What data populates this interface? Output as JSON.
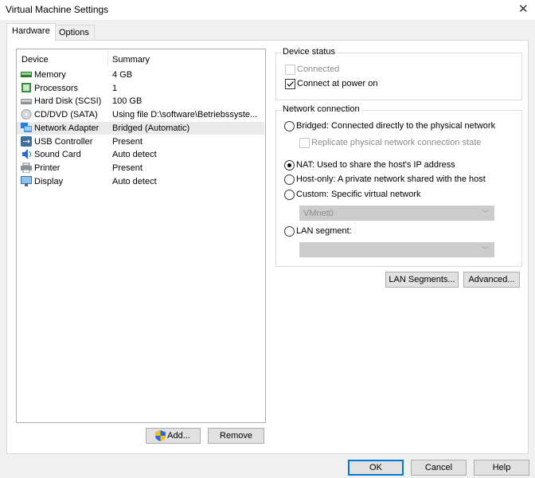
{
  "window": {
    "title": "Virtual Machine Settings",
    "close_icon": "close-icon"
  },
  "tabs": [
    {
      "label": "Hardware",
      "active": true
    },
    {
      "label": "Options",
      "active": false
    }
  ],
  "device_list": {
    "headers": {
      "device": "Device",
      "summary": "Summary"
    },
    "rows": [
      {
        "device": "Memory",
        "summary": "4 GB",
        "icon": "memory-icon"
      },
      {
        "device": "Processors",
        "summary": "1",
        "icon": "processor-icon"
      },
      {
        "device": "Hard Disk (SCSI)",
        "summary": "100 GB",
        "icon": "hard-disk-icon"
      },
      {
        "device": "CD/DVD (SATA)",
        "summary": "Using file D:\\software\\Betriebssyste...",
        "icon": "cd-dvd-icon"
      },
      {
        "device": "Network Adapter",
        "summary": "Bridged (Automatic)",
        "icon": "network-adapter-icon",
        "selected": true
      },
      {
        "device": "USB Controller",
        "summary": "Present",
        "icon": "usb-icon"
      },
      {
        "device": "Sound Card",
        "summary": "Auto detect",
        "icon": "sound-card-icon"
      },
      {
        "device": "Printer",
        "summary": "Present",
        "icon": "printer-icon"
      },
      {
        "device": "Display",
        "summary": "Auto detect",
        "icon": "display-icon"
      }
    ],
    "add_label": "Add...",
    "remove_label": "Remove"
  },
  "device_status": {
    "title": "Device status",
    "connected": {
      "label": "Connected",
      "checked": false,
      "disabled": true
    },
    "connect_power_on": {
      "label": "Connect at power on",
      "checked": true
    }
  },
  "network_connection": {
    "title": "Network connection",
    "bridged": "Bridged: Connected directly to the physical network",
    "replicate": "Replicate physical network connection state",
    "nat": "NAT: Used to share the host's IP address",
    "host_only": "Host-only: A private network shared with the host",
    "custom": "Custom: Specific virtual network",
    "custom_value": "VMnet0",
    "lan_segment": "LAN segment:",
    "lan_segment_value": "",
    "selected": "nat"
  },
  "buttons": {
    "lan_segments": "LAN Segments...",
    "advanced": "Advanced...",
    "ok": "OK",
    "cancel": "Cancel",
    "help": "Help"
  },
  "colors": {
    "default_button_border": "#0078d7",
    "selection": "#eaeaea"
  }
}
